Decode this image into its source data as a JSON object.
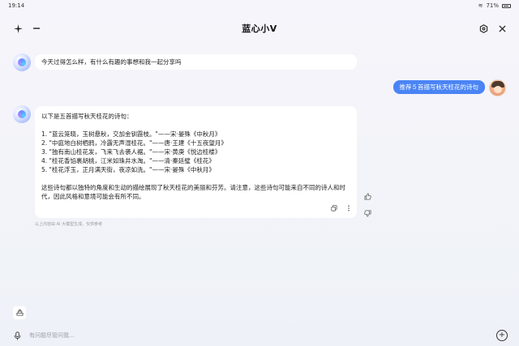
{
  "status": {
    "time": "19:14",
    "battery": "71%"
  },
  "header": {
    "title": "蓝心小V",
    "new_chat_icon": "sparkle-icon",
    "minimize_icon": "minus-icon",
    "settings_icon": "gear-icon",
    "close_icon": "close-icon"
  },
  "messages": {
    "bot_greeting": "今天过得怎么样，有什么有趣的事想和我一起分享吗",
    "user_query": "推荐５首描写秋天桂花的诗句",
    "answer": {
      "intro": "以下是五首描写秋天桂花的诗句：",
      "items": [
        "1. \"蓝云笼晓，玉树悬秋，交加金钏霞枝。\"——宋·晏殊《中秋月》",
        "2. \"中庭地白树栖鸦，冷露无声湿桂花。\"——唐·王建《十五夜望月》",
        "3. \"独有南山桂花发，飞来飞去袭人裾。\"——宋·黄庚《悦边桂楼》",
        "4. \"桂花香馅裹胡桃，江米如珠井水淘。\"——清·秦廷璧《桂花》",
        "5. \"桂花浮玉，正月满天街，夜凉如洗。\"——宋·晏殊《中秋月》"
      ],
      "outro": "这些诗句都以独特的角度和生动的描绘展现了秋天桂花的美丽和芬芳。请注意，这些诗句可能来自不同的诗人和时代，因此风格和意境可能会有所不同。"
    }
  },
  "disclaimer": "以上内容由 AI 大模型生成，仅供参考",
  "input": {
    "placeholder": "有问题尽管问我..."
  }
}
